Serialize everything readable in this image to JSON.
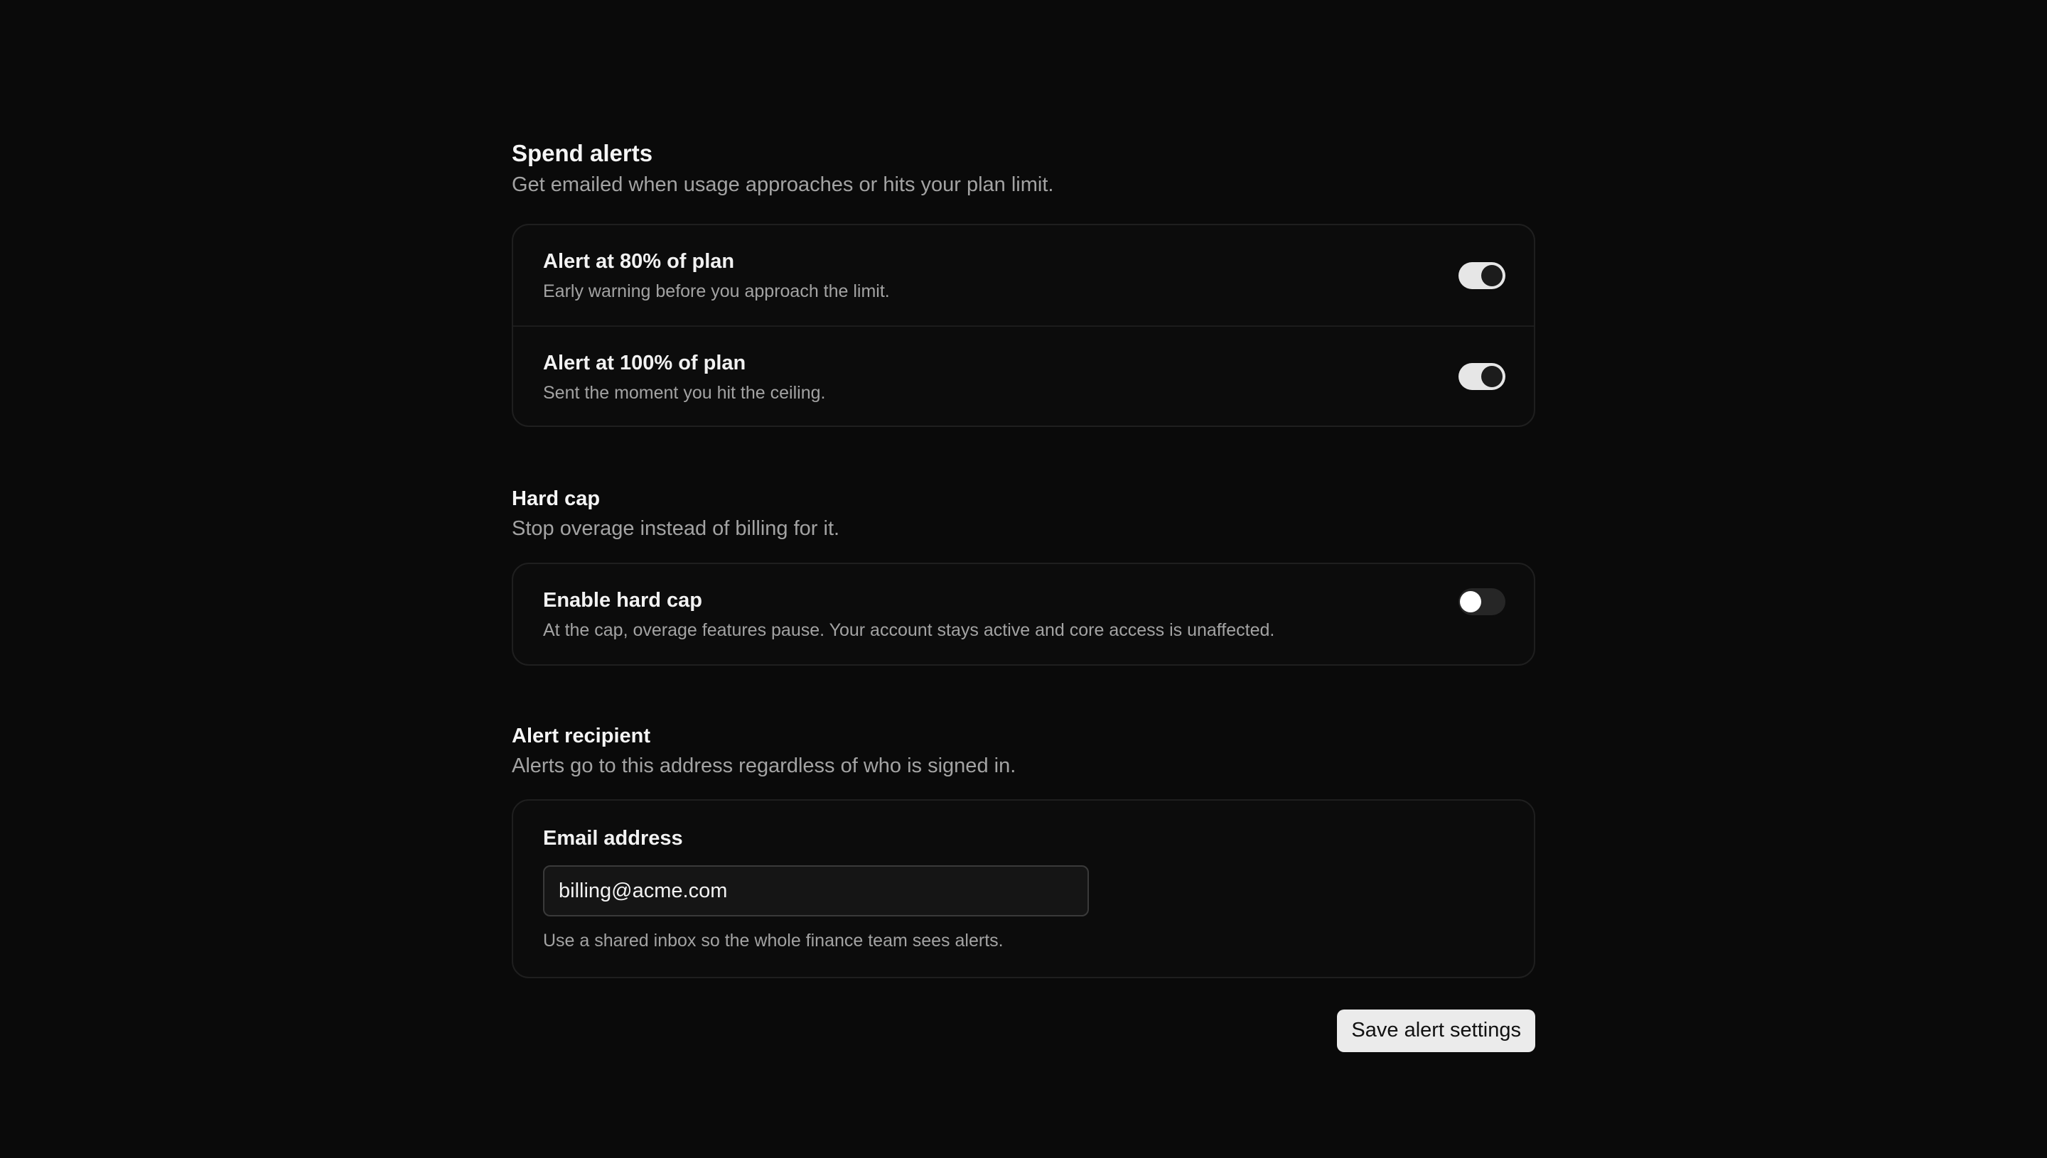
{
  "spend_alerts": {
    "title": "Spend alerts",
    "description": "Get emailed when usage approaches or hits your plan limit.",
    "rows": [
      {
        "title": "Alert at 80% of plan",
        "description": "Early warning before you approach the limit.",
        "enabled": true
      },
      {
        "title": "Alert at 100% of plan",
        "description": "Sent the moment you hit the ceiling.",
        "enabled": true
      }
    ]
  },
  "hard_cap": {
    "title": "Hard cap",
    "description": "Stop overage instead of billing for it.",
    "row": {
      "title": "Enable hard cap",
      "description": "At the cap, overage features pause. Your account stays active and core access is unaffected.",
      "enabled": false
    }
  },
  "alert_recipient": {
    "title": "Alert recipient",
    "description": "Alerts go to this address regardless of who is signed in.",
    "field_label": "Email address",
    "email_value": "billing@acme.com",
    "hint": "Use a shared inbox so the whole finance team sees alerts."
  },
  "actions": {
    "save_label": "Save alert settings"
  },
  "colors": {
    "background": "#0a0a0a",
    "toggle_on": "#e6e6e6",
    "toggle_off": "#262626",
    "button": "#ebebeb"
  }
}
